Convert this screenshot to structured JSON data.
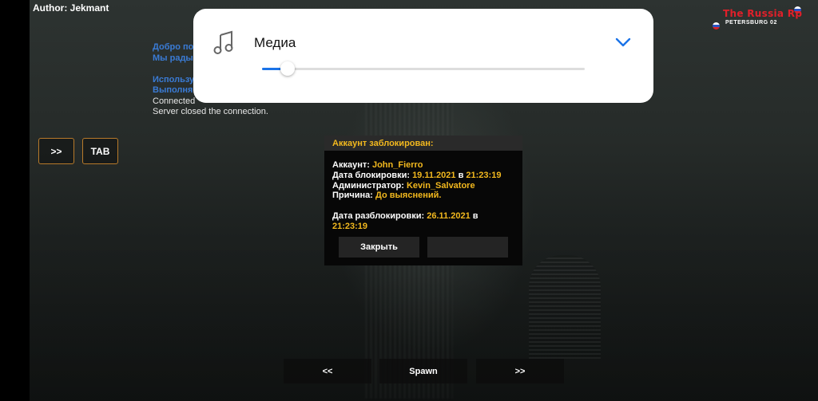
{
  "author": "Author: Jekmant",
  "logo": {
    "title": "The Russia Rp",
    "subtitle": "PETERSBURG 02"
  },
  "chat": {
    "line1": "Добро по",
    "line2": "Мы рады",
    "line3": "Использу",
    "line4": "Выполня",
    "line5": "Connected",
    "line6": "Server closed the connection."
  },
  "side_buttons": {
    "next": ">>",
    "tab": "TAB"
  },
  "media": {
    "title": "Медиа",
    "volume_fraction": 0.08,
    "icon": "music-note-icon",
    "expand_icon": "chevron-down-icon",
    "accent": "#1a73e8"
  },
  "dialog": {
    "title": "Аккаунт заблокирован:",
    "account_label": "Аккаунт:",
    "account_value": "John_Fierro",
    "date_label": "Дата блокировки:",
    "date_value": "19.11.2021",
    "in_word": "в",
    "time_value": "21:23:19",
    "admin_label": "Администратор:",
    "admin_value": "Kevin_Salvatore",
    "reason_label": "Причина:",
    "reason_value": "До выяснений.",
    "unblock_label": "Дата разблокировки:",
    "unblock_date": "26.11.2021",
    "unblock_in": "в",
    "unblock_time": "21:23:19",
    "close_button": "Закрыть",
    "second_button": ""
  },
  "bottom_nav": {
    "prev": "<<",
    "spawn": "Spawn",
    "next": ">>"
  },
  "colors": {
    "highlight": "#f2b81e",
    "chat_blue": "#3a7bd5",
    "brand_red": "#e0202a"
  }
}
